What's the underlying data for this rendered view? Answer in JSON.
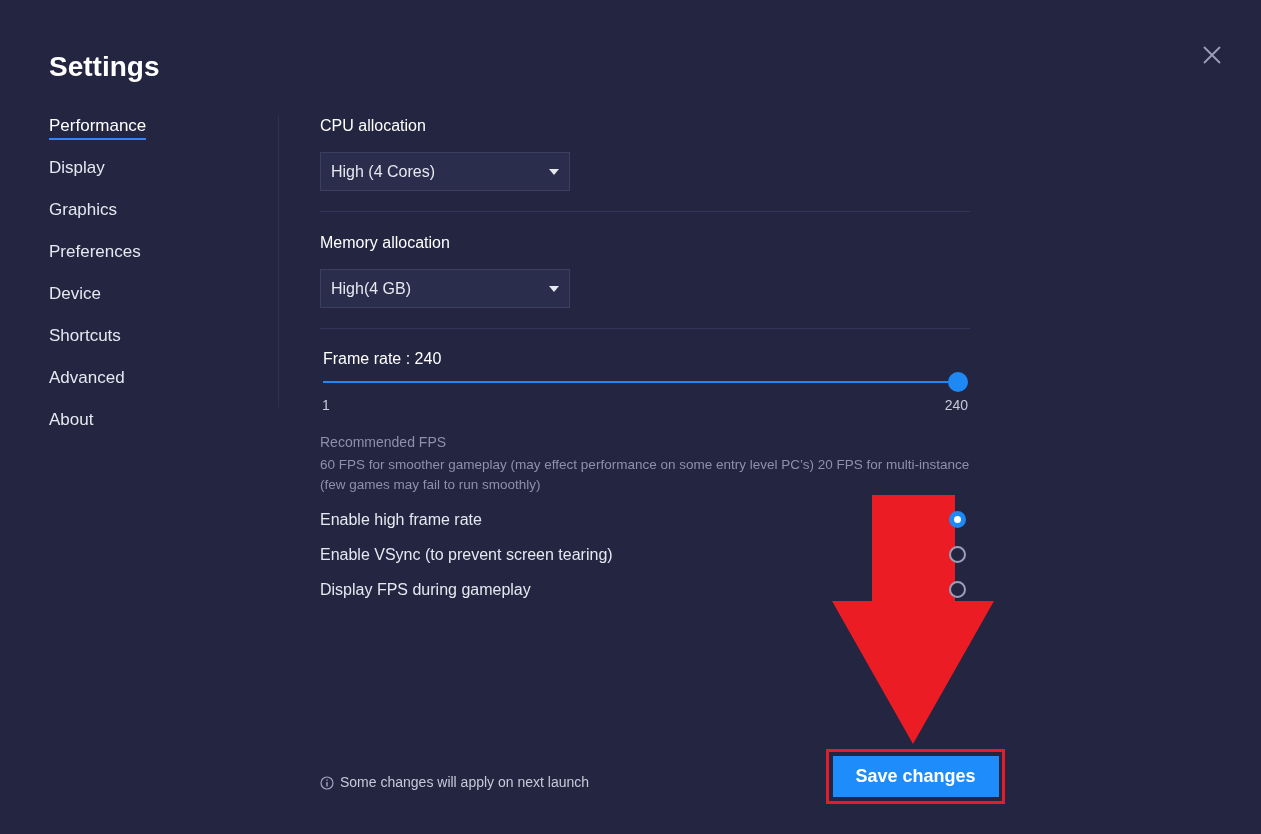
{
  "title": "Settings",
  "sidebar": {
    "items": [
      {
        "label": "Performance",
        "selected": true
      },
      {
        "label": "Display",
        "selected": false
      },
      {
        "label": "Graphics",
        "selected": false
      },
      {
        "label": "Preferences",
        "selected": false
      },
      {
        "label": "Device",
        "selected": false
      },
      {
        "label": "Shortcuts",
        "selected": false
      },
      {
        "label": "Advanced",
        "selected": false
      },
      {
        "label": "About",
        "selected": false
      }
    ]
  },
  "cpu": {
    "label": "CPU allocation",
    "value": "High (4 Cores)"
  },
  "memory": {
    "label": "Memory allocation",
    "value": "High(4 GB)"
  },
  "frame_rate": {
    "label": "Frame rate : 240",
    "level": 1,
    "min": "1",
    "max": "240"
  },
  "recommended": {
    "title": "Recommended FPS",
    "text": "60 FPS for smoother gameplay (may effect performance on some entry level PC’s) 20 FPS for multi-instance (few games may fail to run smoothly)"
  },
  "options": [
    {
      "label": "Enable high frame rate",
      "checked": true
    },
    {
      "label": "Enable VSync (to prevent screen tearing)",
      "checked": false
    },
    {
      "label": "Display FPS during gameplay",
      "checked": false
    }
  ],
  "note": "Some changes will apply on next launch",
  "save_button": "Save changes"
}
